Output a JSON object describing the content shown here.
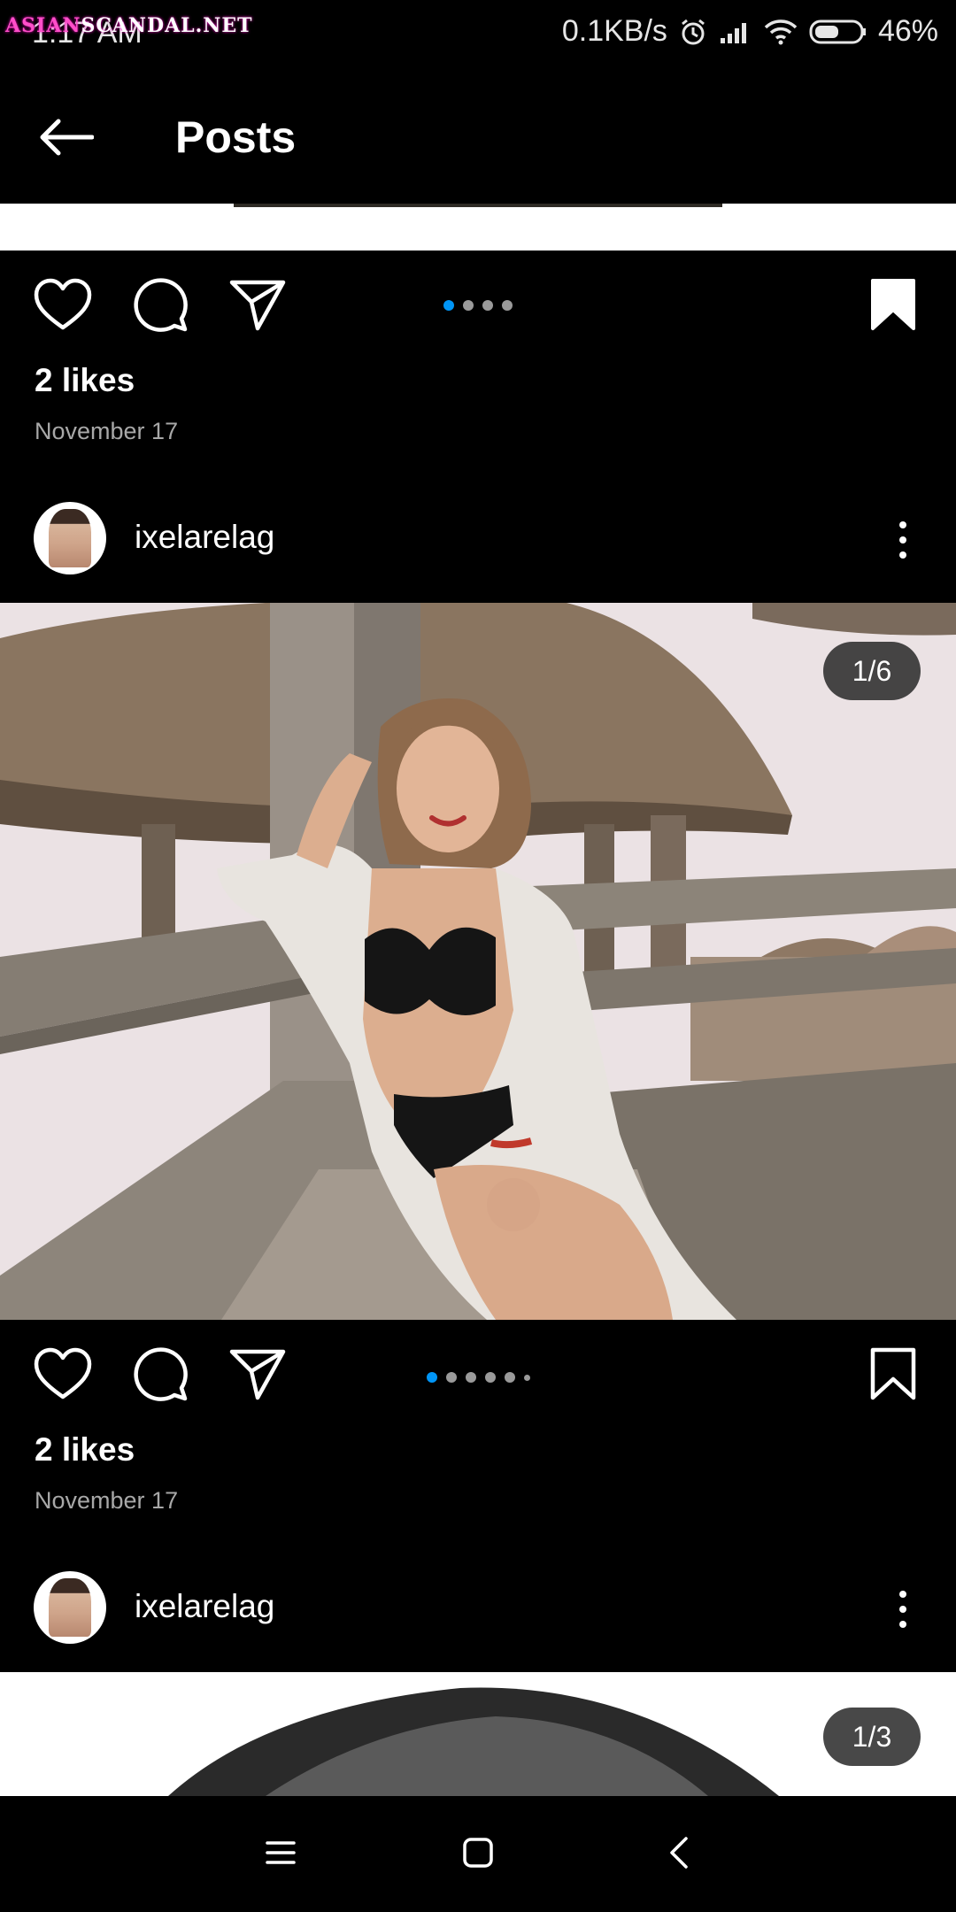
{
  "status_bar": {
    "time": "1:17 AM",
    "network_speed": "0.1KB/s",
    "battery": "46%",
    "icons": [
      "alarm-icon",
      "signal-icon",
      "wifi-icon",
      "battery-icon"
    ]
  },
  "watermark": {
    "part1": "ASIAN",
    "part2": "SCANDAL.NET"
  },
  "header": {
    "title": "Posts",
    "back_icon": "back-arrow-icon"
  },
  "posts": [
    {
      "likes": "2 likes",
      "date": "November 17",
      "saved": true,
      "carousel_dots": 4,
      "active_dot": 1
    },
    {
      "username": "ixelarelag",
      "counter": "1/6",
      "likes": "2 likes",
      "date": "November 17",
      "saved": false,
      "carousel_dots": 6,
      "active_dot": 1
    },
    {
      "username": "ixelarelag",
      "counter": "1/3"
    }
  ],
  "colors": {
    "accent": "#0095f6",
    "background": "#000000",
    "muted_text": "#a8a8a8"
  }
}
